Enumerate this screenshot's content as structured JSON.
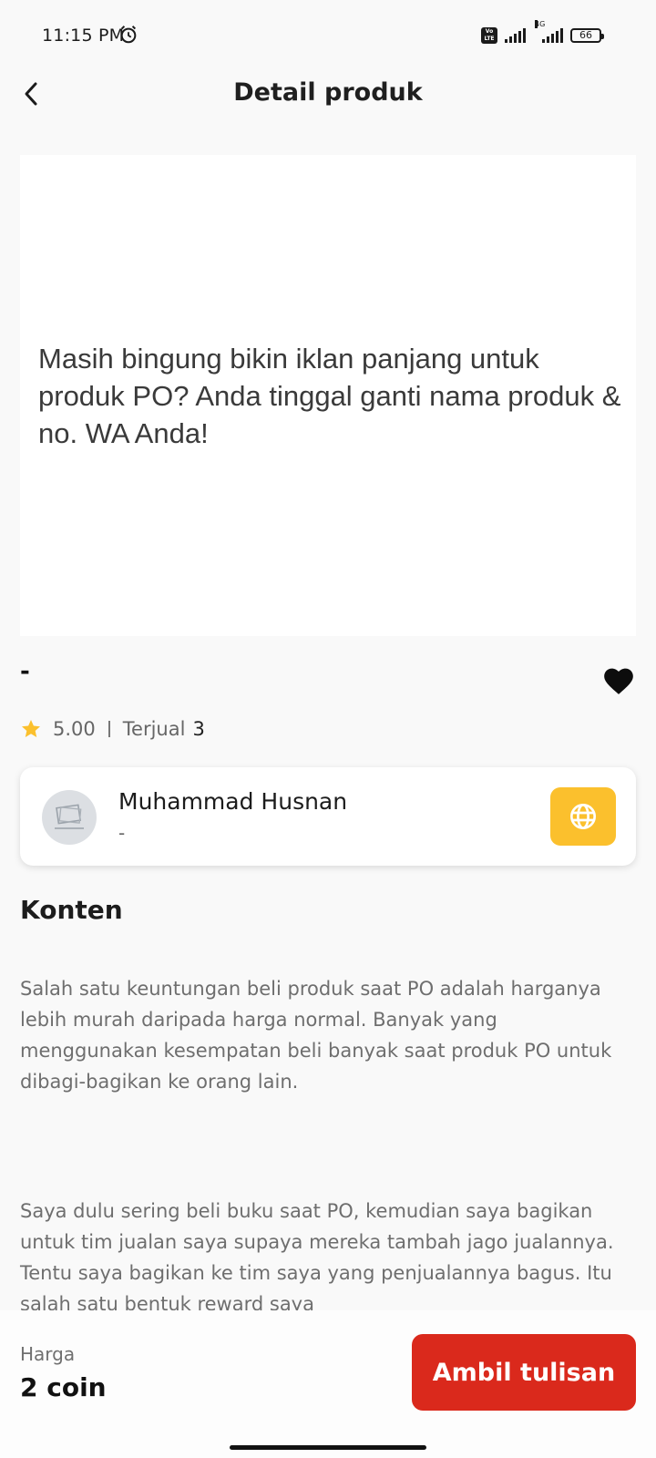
{
  "status_bar": {
    "time": "11:15 PM",
    "volte_label": "Vo LTE",
    "network_label": "4G",
    "battery": "66"
  },
  "header": {
    "title": "Detail produk"
  },
  "product": {
    "image_text": "Masih bingung bikin iklan panjang untuk produk PO? Anda tinggal ganti nama produk & no. WA Anda!",
    "name": "-",
    "rating": "5.00",
    "sold_label": "Terjual",
    "sold_count": "3",
    "favorited": true
  },
  "seller": {
    "name": "Muhammad Husnan",
    "subtitle": "-"
  },
  "content": {
    "section_title": "Konten",
    "paragraphs": [
      "Salah satu keuntungan beli produk saat PO adalah harganya lebih murah daripada harga normal. Banyak yang menggunakan kesempatan beli banyak saat produk PO untuk dibagi-bagikan ke orang lain.",
      "Saya dulu sering beli buku saat PO, kemudian saya bagikan untuk tim jualan saya supaya mereka tambah jago jualannya. Tentu saya bagikan ke tim saya yang penjualannya bagus. Itu salah satu bentuk reward saya"
    ]
  },
  "footer": {
    "price_label": "Harga",
    "price_value": "2 coin",
    "cta_label": "Ambil tulisan"
  },
  "colors": {
    "accent_red": "#da291c",
    "accent_yellow": "#fbc02d",
    "star": "#fbc02d"
  },
  "icons": [
    "alarm-icon",
    "back-arrow-icon",
    "heart-icon",
    "star-icon",
    "globe-icon"
  ]
}
